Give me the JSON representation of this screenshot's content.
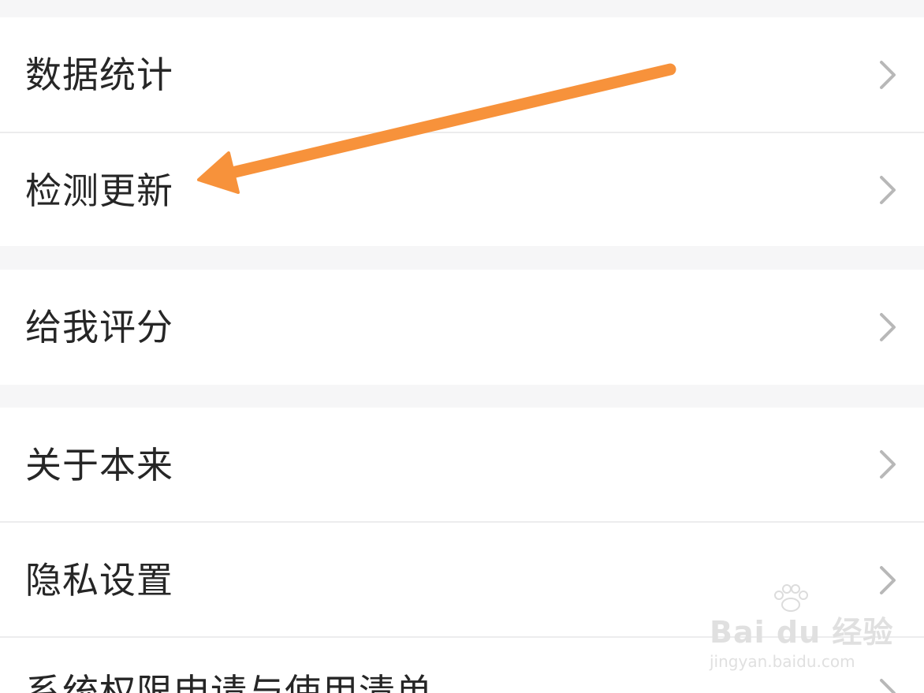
{
  "menu": {
    "items": [
      {
        "label": "数据统计",
        "icon": "chevron-right-icon"
      },
      {
        "label": "检测更新",
        "icon": "chevron-right-icon"
      },
      {
        "label": "给我评分",
        "icon": "chevron-right-icon"
      },
      {
        "label": "关于本来",
        "icon": "chevron-right-icon"
      },
      {
        "label": "隐私设置",
        "icon": "chevron-right-icon"
      },
      {
        "label": "系统权限申请与使用清单",
        "icon": "chevron-right-icon"
      }
    ]
  },
  "annotation": {
    "arrow_color": "#f7923b",
    "points_to": "检测更新"
  },
  "watermark": {
    "brand": "Bai du 经验",
    "url": "jingyan.baidu.com"
  },
  "colors": {
    "background": "#f7f7f8",
    "row": "#ffffff",
    "text": "#262626",
    "chevron": "#b8b8b8",
    "divider": "#ececed"
  }
}
